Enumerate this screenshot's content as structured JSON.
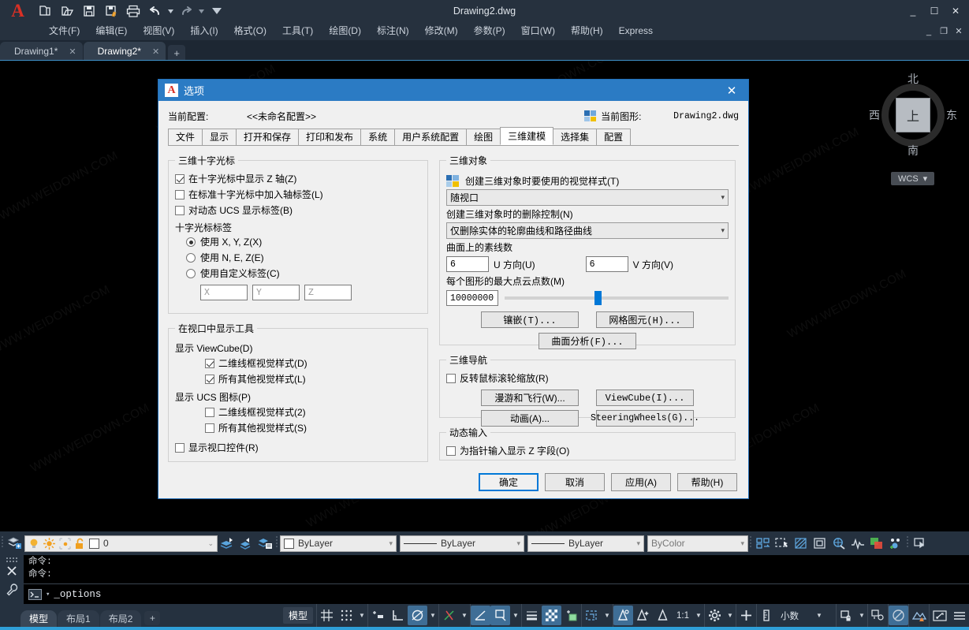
{
  "window": {
    "title": "Drawing2.dwg",
    "logo": "A",
    "minimize": "_",
    "maximize": "☐",
    "close": "✕"
  },
  "quick_access": [
    {
      "name": "new-file-icon",
      "label": "新建"
    },
    {
      "name": "open-file-icon",
      "label": "打开"
    },
    {
      "name": "save-icon",
      "label": "保存"
    },
    {
      "name": "save-as-icon",
      "label": "另存为"
    },
    {
      "name": "print-icon",
      "label": "打印"
    },
    {
      "name": "undo-icon",
      "label": "放弃"
    },
    {
      "name": "redo-icon",
      "label": "重做"
    },
    {
      "name": "qat-customize-icon",
      "label": "自定义"
    }
  ],
  "menubar": {
    "items": [
      "文件(F)",
      "编辑(E)",
      "视图(V)",
      "插入(I)",
      "格式(O)",
      "工具(T)",
      "绘图(D)",
      "标注(N)",
      "修改(M)",
      "参数(P)",
      "窗口(W)",
      "帮助(H)",
      "Express"
    ],
    "doc_controls": [
      "_",
      "❐",
      "✕"
    ]
  },
  "doc_tabs": {
    "tabs": [
      {
        "label": "Drawing1*",
        "close": "✕",
        "active": false
      },
      {
        "label": "Drawing2*",
        "close": "✕",
        "active": true
      }
    ],
    "add_label": "+"
  },
  "viewcube": {
    "top": "上",
    "north": "北",
    "south": "南",
    "west": "西",
    "east": "东",
    "wcs_label": "WCS",
    "wcs_arrow": "▾"
  },
  "watermark_text": "WWW.WEIDOWN.COM",
  "dialog": {
    "title": "选项",
    "logo": "A",
    "close": "✕",
    "current_profile_label": "当前配置:",
    "current_profile_value": "<<未命名配置>>",
    "current_drawing_label": "当前图形:",
    "current_drawing_value": "Drawing2.dwg",
    "tabs": [
      {
        "label": "文件",
        "active": false
      },
      {
        "label": "显示",
        "active": false
      },
      {
        "label": "打开和保存",
        "active": false
      },
      {
        "label": "打印和发布",
        "active": false
      },
      {
        "label": "系统",
        "active": false
      },
      {
        "label": "用户系统配置",
        "active": false
      },
      {
        "label": "绘图",
        "active": false
      },
      {
        "label": "三维建模",
        "active": true
      },
      {
        "label": "选择集",
        "active": false
      },
      {
        "label": "配置",
        "active": false
      }
    ],
    "groups": {
      "crosshair": {
        "legend": "三维十字光标",
        "checkboxes": [
          {
            "label": "在十字光标中显示 Z 轴(Z)",
            "checked": true
          },
          {
            "label": "在标准十字光标中加入轴标签(L)",
            "checked": false
          },
          {
            "label": "对动态 UCS 显示标签(B)",
            "checked": false
          }
        ],
        "labels_title": "十字光标标签",
        "radios": [
          {
            "label": "使用 X, Y, Z(X)",
            "selected": true
          },
          {
            "label": "使用 N, E, Z(E)",
            "selected": false
          },
          {
            "label": "使用自定义标签(C)",
            "selected": false
          }
        ],
        "custom_fields": [
          {
            "value": "",
            "placeholder": "X"
          },
          {
            "value": "",
            "placeholder": "Y"
          },
          {
            "value": "",
            "placeholder": "Z"
          }
        ]
      },
      "viewport_tools": {
        "legend": "在视口中显示工具",
        "viewcube_title": "显示 ViewCube(D)",
        "viewcube_checkboxes": [
          {
            "label": "二维线框视觉样式(D)",
            "checked": true
          },
          {
            "label": "所有其他视觉样式(L)",
            "checked": true
          }
        ],
        "ucs_title": "显示 UCS 图标(P)",
        "ucs_checkboxes": [
          {
            "label": "二维线框视觉样式(2)",
            "checked": false
          },
          {
            "label": "所有其他视觉样式(S)",
            "checked": false
          }
        ],
        "viewport_control": {
          "label": "显示视口控件(R)",
          "checked": false
        }
      },
      "objects_3d": {
        "legend": "三维对象",
        "visual_style_label": "创建三维对象时要使用的视觉样式(T)",
        "visual_style_value": "随视口",
        "deletion_label": "创建三维对象时的删除控制(N)",
        "deletion_value": "仅删除实体的轮廓曲线和路径曲线",
        "isolines_title": "曲面上的素线数",
        "u_value": "6",
        "u_label": "U 方向(U)",
        "v_value": "6",
        "v_label": "V 方向(V)",
        "pointcloud_label": "每个图形的最大点云点数(M)",
        "pointcloud_value": "10000000",
        "pointcloud_slider_pct": 39,
        "buttons": [
          {
            "label": "镶嵌(T)..."
          },
          {
            "label": "网格图元(H)..."
          },
          {
            "label": "曲面分析(F)..."
          }
        ]
      },
      "nav_3d": {
        "legend": "三维导航",
        "reverse_wheel": {
          "label": "反转鼠标滚轮缩放(R)",
          "checked": false
        },
        "buttons": [
          {
            "label": "漫游和飞行(W)..."
          },
          {
            "label": "ViewCube(I)..."
          },
          {
            "label": "动画(A)..."
          },
          {
            "label": "SteeringWheels(G)..."
          }
        ]
      },
      "dynamic_input": {
        "legend": "动态输入",
        "checkbox": {
          "label": "为指针输入显示 Z 字段(O)",
          "checked": false
        }
      }
    },
    "footer_buttons": [
      {
        "label": "确定",
        "default": true
      },
      {
        "label": "取消",
        "default": false
      },
      {
        "label": "应用(A)",
        "default": false
      },
      {
        "label": "帮助(H)",
        "default": false
      }
    ]
  },
  "layer_toolbar": {
    "layer_properties_icon": "layer-properties-icon",
    "state_icons": [
      "lightbulb-on-icon",
      "sun-icon",
      "freeze-viewport-icon",
      "unlock-icon"
    ],
    "layer_name": "0",
    "layer_arrow": "⌄",
    "extra_icons": [
      "layer-make-current-icon",
      "layer-previous-icon",
      "layer-states-icon"
    ],
    "properties": [
      {
        "name": "color-combo",
        "value": "ByLayer",
        "kind": "swatch"
      },
      {
        "name": "linetype-combo",
        "value": "ByLayer",
        "kind": "line"
      },
      {
        "name": "lineweight-combo",
        "value": "ByLayer",
        "kind": "line"
      },
      {
        "name": "plotstyle-combo",
        "value": "ByColor",
        "kind": "plain"
      }
    ],
    "right_icons": [
      "group-icon",
      "group-edit-icon",
      "group-selection-icon",
      "block-editor-icon",
      "find-icon",
      "measure-icon",
      "match-properties-icon",
      "add-selected-icon",
      "isolate-objects-icon"
    ]
  },
  "command_line": {
    "history": [
      "命令:",
      "命令:"
    ],
    "prompt_icon": "console-icon",
    "prompt_arrow": "▾",
    "input_value": "_options",
    "rail_icons": [
      "drag-handle-icon",
      "close-icon",
      "customize-wrench-icon"
    ]
  },
  "bottom_bar": {
    "layout_tabs": [
      {
        "label": "模型",
        "active": true
      },
      {
        "label": "布局1",
        "active": false
      },
      {
        "label": "布局2",
        "active": false
      }
    ],
    "add_layout": "+",
    "model_button": "模型",
    "scale_value": "1:1",
    "units_value": "小数",
    "icons": [
      {
        "name": "grid-display-icon",
        "active": false
      },
      {
        "name": "snap-mode-icon",
        "active": false
      },
      {
        "name": "snap-dropdown-arrow",
        "active": false
      },
      {
        "name": "infer-constraints-icon",
        "active": false
      },
      {
        "name": "ortho-mode-icon",
        "active": false
      },
      {
        "name": "polar-tracking-icon",
        "active": true
      },
      {
        "name": "polar-dropdown-arrow",
        "active": false
      },
      {
        "name": "object-snap-icon",
        "active": false
      },
      {
        "name": "osnap-dropdown-arrow",
        "active": false
      },
      {
        "name": "3d-object-snap-icon",
        "active": true
      },
      {
        "name": "object-snap-tracking-icon",
        "active": true
      },
      {
        "name": "osnap-tracking-dropdown-arrow",
        "active": false
      },
      {
        "name": "lineweight-display-icon",
        "active": false
      },
      {
        "name": "transparency-icon",
        "active": true
      },
      {
        "name": "selection-cycling-icon",
        "active": false
      },
      {
        "name": "selection-filter-icon",
        "active": false
      },
      {
        "name": "gizmo-dropdown-arrow",
        "active": false
      },
      {
        "name": "annotation-visibility-icon",
        "active": true
      },
      {
        "name": "auto-scale-icon",
        "active": false
      },
      {
        "name": "annotation-scale-icon",
        "active": false
      },
      {
        "name": "workspace-gear-icon",
        "active": false
      },
      {
        "name": "workspace-dropdown-arrow",
        "active": false
      },
      {
        "name": "annotation-monitor-icon",
        "active": false
      },
      {
        "name": "units-icon",
        "active": false
      },
      {
        "name": "units-dropdown-arrow",
        "active": false
      },
      {
        "name": "isolate-objects-icon",
        "active": false
      },
      {
        "name": "isolate-dropdown-arrow",
        "active": false
      },
      {
        "name": "hardware-accel-icon",
        "active": false
      },
      {
        "name": "clean-screen-icon",
        "active": true
      },
      {
        "name": "graphics-perf-icon",
        "active": false
      },
      {
        "name": "fullscreen-icon",
        "active": false
      },
      {
        "name": "customization-menu-icon",
        "active": false
      }
    ]
  }
}
